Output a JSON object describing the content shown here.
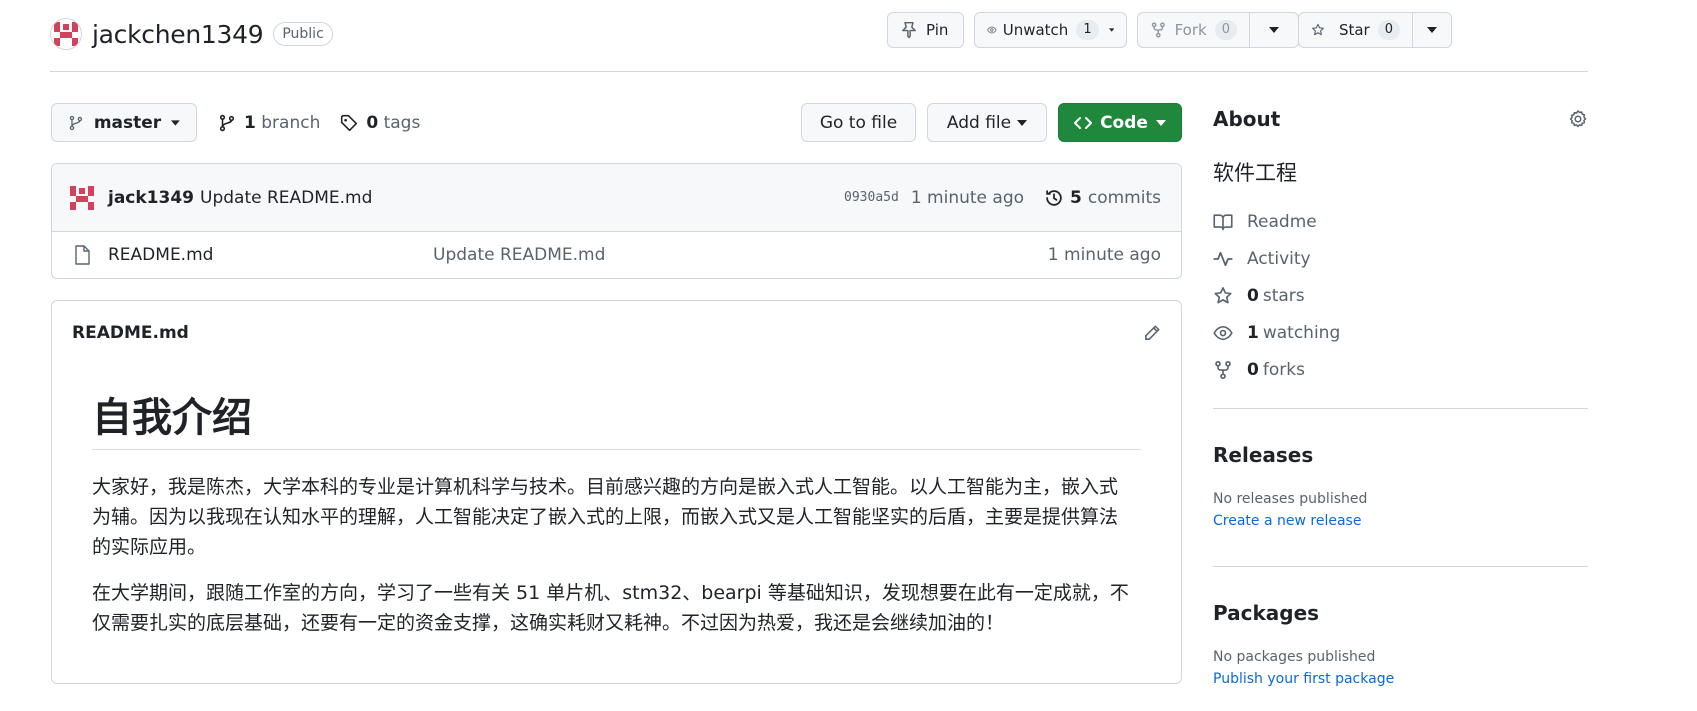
{
  "repo": {
    "owner": "jackchen1349",
    "visibility": "Public"
  },
  "actions": {
    "pin_label": "Pin",
    "unwatch_label": "Unwatch",
    "unwatch_count": "1",
    "fork_label": "Fork",
    "fork_count": "0",
    "star_label": "Star",
    "star_count": "0"
  },
  "branch_bar": {
    "branch": "master",
    "branch_count": "1",
    "branch_word": "branch",
    "tag_count": "0",
    "tag_word": "tags",
    "go_to_file": "Go to file",
    "add_file": "Add file",
    "code": "Code"
  },
  "latest_commit": {
    "author": "jack1349",
    "message": "Update README.md",
    "sha": "0930a5d",
    "age": "1 minute ago",
    "commit_count": "5",
    "commit_word": "commits"
  },
  "files": [
    {
      "name": "README.md",
      "message": "Update README.md",
      "age": "1 minute ago"
    }
  ],
  "readme": {
    "filename": "README.md",
    "heading": "自我介绍",
    "paragraphs": [
      "大家好，我是陈杰，大学本科的专业是计算机科学与技术。目前感兴趣的方向是嵌入式人工智能。以人工智能为主，嵌入式为辅。因为以我现在认知水平的理解，人工智能决定了嵌入式的上限，而嵌入式又是人工智能坚实的后盾，主要是提供算法的实际应用。",
      "在大学期间，跟随工作室的方向，学习了一些有关 51 单片机、stm32、bearpi 等基础知识，发现想要在此有一定成就，不仅需要扎实的底层基础，还要有一定的资金支撑，这确实耗财又耗神。不过因为热爱，我还是会继续加油的！"
    ]
  },
  "about": {
    "title": "About",
    "description": "软件工程",
    "readme": "Readme",
    "activity": "Activity",
    "stars_count": "0",
    "stars_word": "stars",
    "watching_count": "1",
    "watching_word": "watching",
    "forks_count": "0",
    "forks_word": "forks"
  },
  "releases": {
    "title": "Releases",
    "empty": "No releases published",
    "link": "Create a new release"
  },
  "packages": {
    "title": "Packages",
    "empty": "No packages published",
    "link": "Publish your first package"
  },
  "colors": {
    "code_button": "#1f883d",
    "link": "#0969da",
    "muted_text": "#59636e",
    "border": "#d0d7de",
    "avatar_red": "#d1435b"
  }
}
